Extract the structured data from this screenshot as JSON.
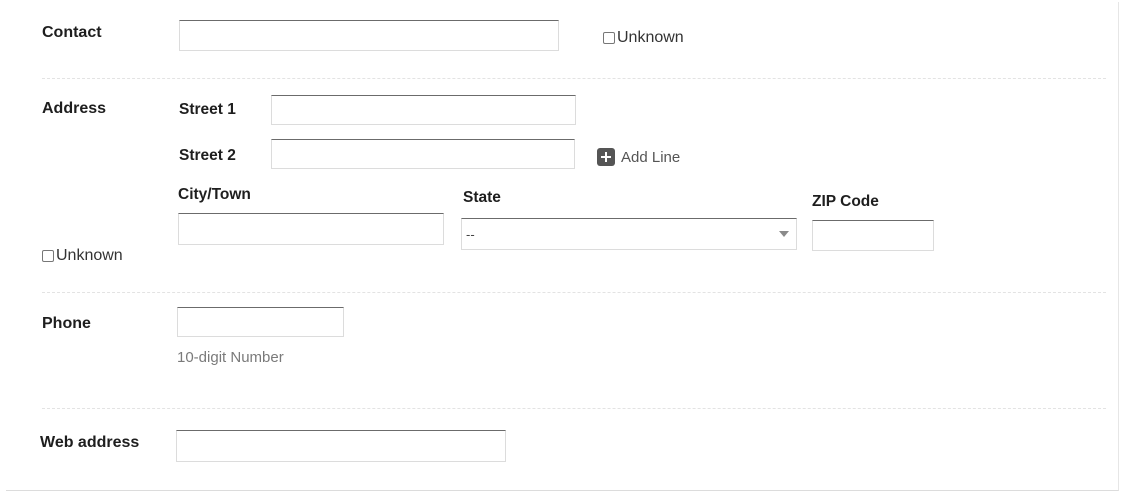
{
  "contact": {
    "label": "Contact",
    "value": "",
    "unknown_label": "Unknown"
  },
  "address": {
    "label": "Address",
    "street1_label": "Street 1",
    "street1_value": "",
    "street2_label": "Street 2",
    "street2_value": "",
    "add_line_label": "Add Line",
    "city_label": "City/Town",
    "city_value": "",
    "state_label": "State",
    "state_selected": "--",
    "zip_label": "ZIP Code",
    "zip_value": "",
    "unknown_label": "Unknown"
  },
  "phone": {
    "label": "Phone",
    "value": "",
    "hint": "10-digit Number"
  },
  "web": {
    "label": "Web address",
    "value": ""
  },
  "icons": {
    "add_line": "plus-square-icon",
    "state_dropdown": "chevron-down-icon"
  }
}
